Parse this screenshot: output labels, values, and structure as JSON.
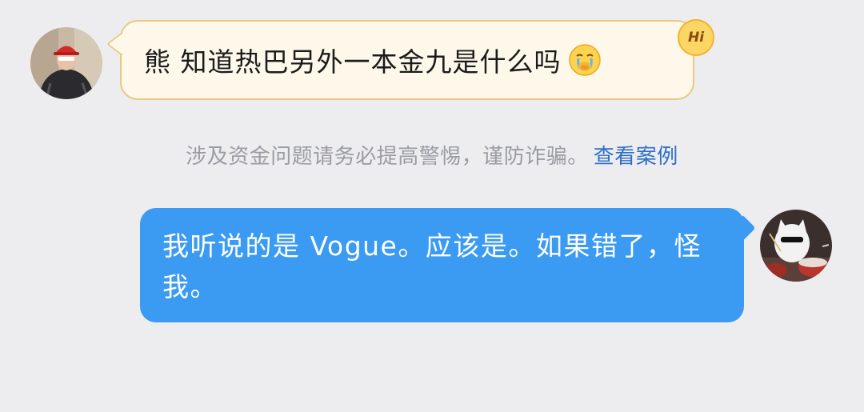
{
  "conversation": {
    "incoming": {
      "text": "熊 知道热巴另外一本金九是什么吗",
      "badge": "Hi",
      "emoji": "crying-face-emoji"
    },
    "notice": {
      "text": "涉及资金问题请务必提高警惕，谨防诈骗。",
      "link": "查看案例"
    },
    "outgoing": {
      "text": "我听说的是 Vogue。应该是。如果错了，怪我。"
    }
  },
  "colors": {
    "background": "#ededf0",
    "incoming_bubble": "#fdf8ea",
    "incoming_border": "#e8c97f",
    "outgoing_bubble": "#3b9af2",
    "link": "#2f6fc6",
    "notice_text": "#9a9ca2"
  }
}
